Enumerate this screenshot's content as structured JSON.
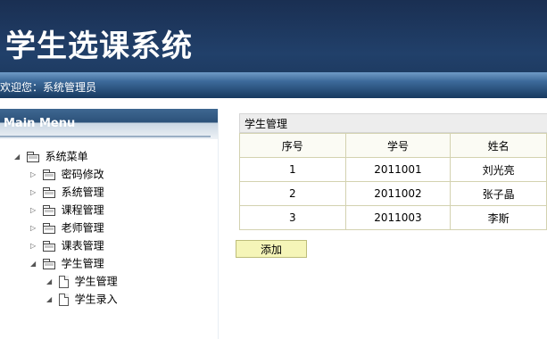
{
  "header": {
    "title": "学生选课系统",
    "welcome": "欢迎您：系统管理员"
  },
  "menu": {
    "title": "Main Menu",
    "root": "系统菜单",
    "items": [
      {
        "label": "密码修改",
        "icon": "folder-icon",
        "expanded": false
      },
      {
        "label": "系统管理",
        "icon": "folder-icon",
        "expanded": false
      },
      {
        "label": "课程管理",
        "icon": "folder-icon",
        "expanded": false
      },
      {
        "label": "老师管理",
        "icon": "folder-icon",
        "expanded": false
      },
      {
        "label": "课表管理",
        "icon": "folder-icon",
        "expanded": false
      },
      {
        "label": "学生管理",
        "icon": "folder-open-icon",
        "expanded": true
      }
    ],
    "subitems": [
      {
        "label": "学生管理",
        "icon": "document-icon"
      },
      {
        "label": "学生录入",
        "icon": "document-icon"
      }
    ]
  },
  "panel": {
    "title": "学生管理",
    "columns": [
      "序号",
      "学号",
      "姓名"
    ],
    "rows": [
      [
        "1",
        "2011001",
        "刘光亮"
      ],
      [
        "2",
        "2011002",
        "张子晶"
      ],
      [
        "3",
        "2011003",
        "李斯"
      ]
    ]
  },
  "buttons": {
    "add": "添加"
  },
  "colors": {
    "header_bg": "#1f3d66",
    "welcome_bar": "#2f5a88",
    "table_border": "#d3d2b0",
    "button_bg": "#f5f5b8"
  }
}
